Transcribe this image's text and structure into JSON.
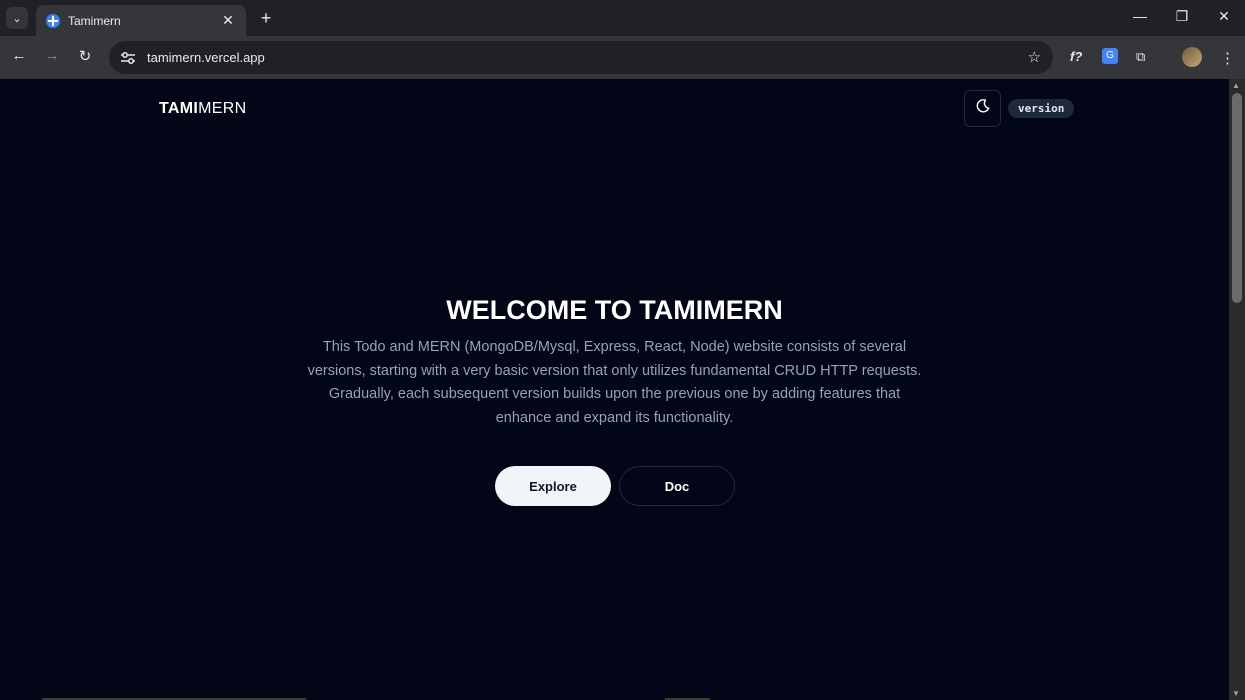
{
  "browser": {
    "tab_title": "Tamimern",
    "url": "tamimern.vercel.app",
    "tab_close": "✕",
    "new_tab": "+",
    "window_controls": {
      "minimize": "—",
      "restore": "❐",
      "close": "✕"
    },
    "nav": {
      "back": "←",
      "forward": "→",
      "reload": "↻"
    },
    "bookmark_icon": "☆",
    "extensions": {
      "fx": "f?",
      "translate": "G",
      "puzzle": "⧉",
      "menu": "⋮"
    }
  },
  "site": {
    "logo_bold": "TAMI",
    "logo_regular": "MERN",
    "version_badge": "version",
    "hero_title": "WELCOME TO TAMIMERN",
    "hero_description": "This Todo and MERN (MongoDB/Mysql, Express, React, Node) website consists of several versions, starting with a very basic version that only utilizes fundamental CRUD HTTP requests. Gradually, each subsequent version builds upon the previous one by adding features that enhance and expand its functionality.",
    "explore_button": "Explore",
    "doc_button": "Doc"
  },
  "colors": {
    "page_background": "#020617",
    "primary_button_bg": "#f1f5f9",
    "badge_bg": "#1e293b",
    "muted_text": "#94a3b8"
  }
}
